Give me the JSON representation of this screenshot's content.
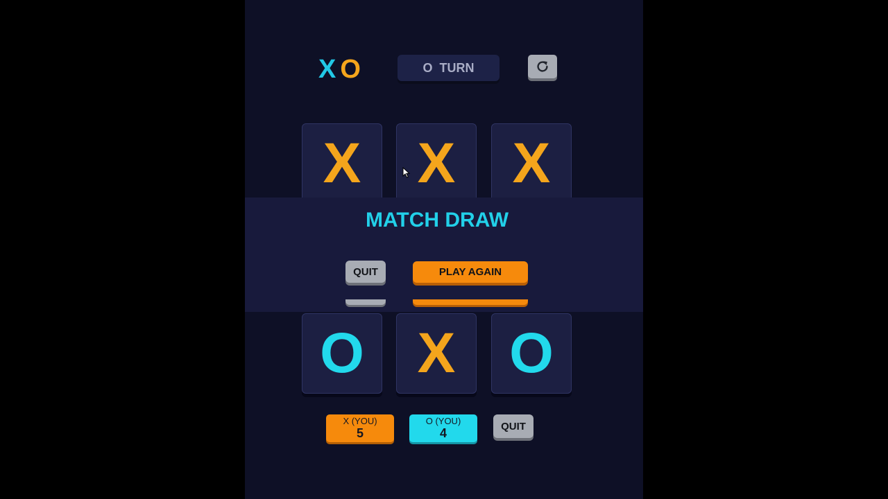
{
  "header": {
    "logo_x": "X",
    "logo_o": "O",
    "turn_mark": "O",
    "turn_label": "TURN",
    "restart_icon": "restart-icon"
  },
  "board": {
    "cells": [
      "X",
      "X",
      "X",
      "",
      "",
      "",
      "O",
      "X",
      "O"
    ]
  },
  "result": {
    "title": "MATCH DRAW",
    "quit_label": "QUIT",
    "play_again_label": "PLAY AGAIN"
  },
  "scores": {
    "x_label": "X (YOU)",
    "x_value": "5",
    "o_label": "O (YOU)",
    "o_value": "4",
    "quit_label": "QUIT"
  },
  "colors": {
    "background": "#0e1026",
    "x_color": "#f4a51c",
    "o_color": "#22d9ec",
    "accent_orange": "#f68a0c",
    "gray_button": "#a8acb4"
  }
}
